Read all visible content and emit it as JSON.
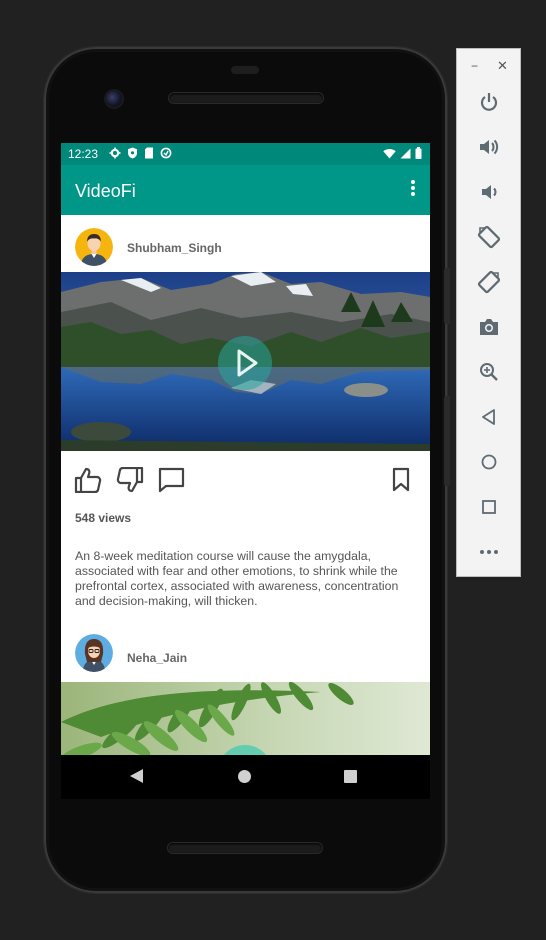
{
  "status_bar": {
    "time": "12:23",
    "left_icons": [
      "gear-icon",
      "shield-icon",
      "sd-card-icon",
      "sync-icon"
    ],
    "right_icons": [
      "wifi-icon",
      "cell-signal-icon",
      "battery-icon"
    ]
  },
  "app_bar": {
    "title": "VideoFi",
    "menu_icon": "more-vert-icon"
  },
  "posts": [
    {
      "username": "Shubham_Singh",
      "views": "548 views",
      "description": "An 8-week meditation course will cause the amygdala, associated with fear and other emotions, to shrink while the prefrontal cortex, associated with awareness, concentration and decision-making, will thicken."
    },
    {
      "username": "Neha_Jain"
    }
  ],
  "colors": {
    "app_bar": "#009688",
    "status_bar": "#00897b",
    "play_overlay": "#26a69a"
  },
  "emulator_toolbar": {
    "window_controls": [
      "minimize-icon",
      "close-icon"
    ],
    "buttons": [
      "power-icon",
      "volume-up-icon",
      "volume-down-icon",
      "rotate-left-icon",
      "rotate-right-icon",
      "camera-icon",
      "zoom-icon",
      "back-icon",
      "home-icon",
      "overview-icon",
      "more-icon"
    ]
  }
}
